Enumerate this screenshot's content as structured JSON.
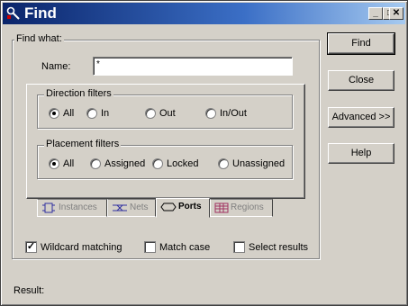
{
  "window": {
    "title": "Find"
  },
  "titlebar_buttons": {
    "minimize": "_",
    "maximize": "□",
    "close": "✕"
  },
  "find_what": {
    "label": "Find what:",
    "name_label": "Name:",
    "name_value": "*"
  },
  "direction": {
    "label": "Direction filters",
    "options": [
      "All",
      "In",
      "Out",
      "In/Out"
    ],
    "selected": "All"
  },
  "placement": {
    "label": "Placement filters",
    "options": [
      "All",
      "Assigned",
      "Locked",
      "Unassigned"
    ],
    "selected": "All"
  },
  "tabs": [
    {
      "label": "Instances",
      "icon": "instances-icon",
      "active": false
    },
    {
      "label": "Nets",
      "icon": "nets-icon",
      "active": false
    },
    {
      "label": "Ports",
      "icon": "ports-icon",
      "active": true
    },
    {
      "label": "Regions",
      "icon": "regions-icon",
      "active": false
    }
  ],
  "options": {
    "wildcard": {
      "label": "Wildcard matching",
      "checked": true
    },
    "match_case": {
      "label": "Match case",
      "checked": false
    },
    "select_results": {
      "label": "Select results",
      "checked": false
    }
  },
  "buttons": {
    "find": "Find",
    "close": "Close",
    "advanced": "Advanced >>",
    "help": "Help"
  },
  "result": {
    "label": "Result:"
  }
}
